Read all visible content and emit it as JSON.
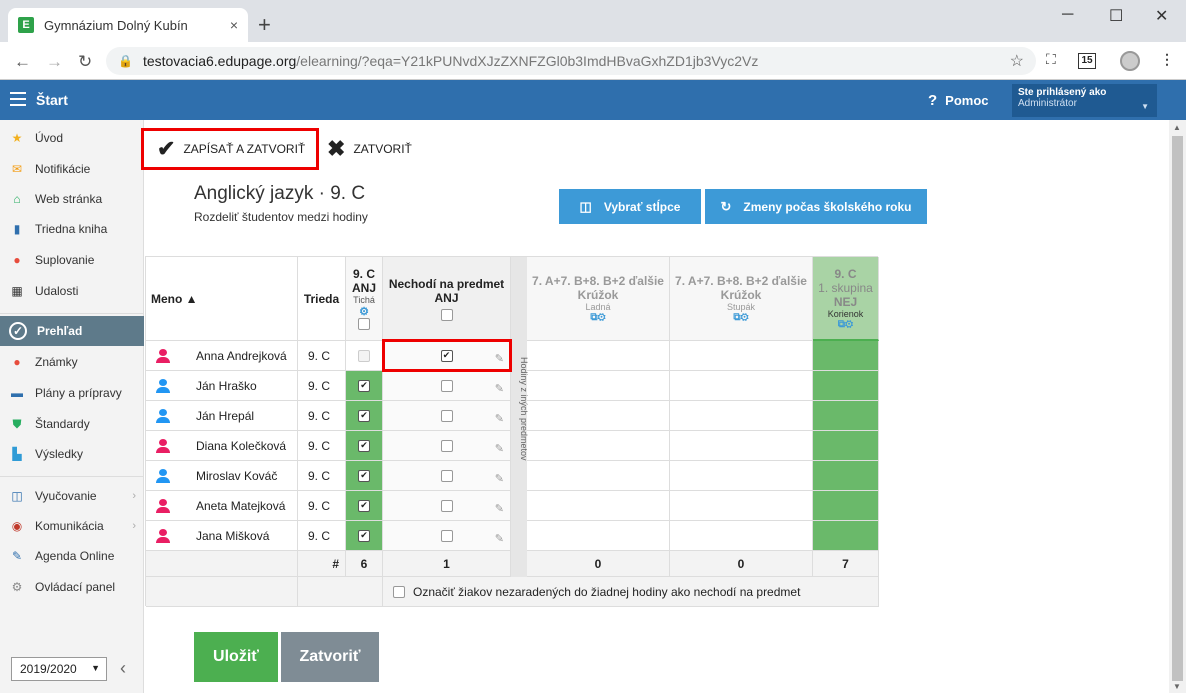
{
  "browser": {
    "tab_title": "Gymnázium Dolný Kubín",
    "favicon_letter": "E",
    "tab_close": "×",
    "new_tab": "+",
    "url_domain": "testovacia6.edupage.org",
    "url_path": "/elearning/?eqa=Y21kPUNvdXJzZXNFZGl0b3ImdHBvaGxhZD1jb3Vyc2Vz",
    "ext_badge": "15"
  },
  "header": {
    "menu_label": "Štart",
    "help_label": "Pomoc",
    "user_line1": "Ste prihlásený ako",
    "user_line2": "Administrátor"
  },
  "sidebar": {
    "items": [
      {
        "label": "Úvod",
        "icon": "star-icon"
      },
      {
        "label": "Notifikácie",
        "icon": "envelope-icon"
      },
      {
        "label": "Web stránka",
        "icon": "home-icon"
      },
      {
        "label": "Triedna kniha",
        "icon": "book-icon"
      },
      {
        "label": "Suplovanie",
        "icon": "person-icon"
      },
      {
        "label": "Udalosti",
        "icon": "calendar-icon"
      },
      {
        "label": "Prehľad",
        "icon": "check-circle-icon"
      },
      {
        "label": "Známky",
        "icon": "grade-icon"
      },
      {
        "label": "Plány a prípravy",
        "icon": "briefcase-icon"
      },
      {
        "label": "Štandardy",
        "icon": "shield-icon"
      },
      {
        "label": "Výsledky",
        "icon": "bar-chart-icon"
      },
      {
        "label": "Vyučovanie",
        "icon": "open-book-icon"
      },
      {
        "label": "Komunikácia",
        "icon": "chat-icon"
      },
      {
        "label": "Agenda Online",
        "icon": "pen-icon"
      },
      {
        "label": "Ovládací panel",
        "icon": "gear-icon"
      }
    ],
    "year": "2019/2020"
  },
  "toolbar": {
    "save_close": "ZAPÍSAŤ A ZATVORIŤ",
    "close": "ZATVORIŤ"
  },
  "page": {
    "title": "Anglický jazyk · 9. C",
    "subtitle": "Rozdeliť študentov medzi hodiny",
    "btn_columns": "Vybrať stĺpce",
    "btn_changes": "Zmeny počas školského roku"
  },
  "table": {
    "col_name": "Meno ▲",
    "col_class": "Trieda",
    "col_group": {
      "line1": "9. C",
      "line2": "ANJ",
      "line3": "Tichá"
    },
    "col_notsubject": {
      "line1": "Nechodí na predmet",
      "line2": "ANJ"
    },
    "strip_text": "Hodiny z iných predmetov",
    "col_k1": {
      "line1": "7. A+7. B+8. B+2 ďalšie",
      "line2": "Krúžok",
      "line3": "Ladná"
    },
    "col_k2": {
      "line1": "7. A+7. B+8. B+2 ďalšie",
      "line2": "Krúžok",
      "line3": "Stupák"
    },
    "col_g": {
      "line1": "9. C",
      "line2": "1. skupina",
      "line3": "NEJ",
      "line4": "Korienok"
    },
    "students": [
      {
        "name": "Anna Andrejková",
        "class": "9. C",
        "gender": "f",
        "group": false,
        "not_subject": true
      },
      {
        "name": "Ján Hraško",
        "class": "9. C",
        "gender": "m",
        "group": true,
        "not_subject": false
      },
      {
        "name": "Ján Hrepál",
        "class": "9. C",
        "gender": "m",
        "group": true,
        "not_subject": false
      },
      {
        "name": "Diana Kolečková",
        "class": "9. C",
        "gender": "f",
        "group": true,
        "not_subject": false
      },
      {
        "name": "Miroslav Kováč",
        "class": "9. C",
        "gender": "m",
        "group": true,
        "not_subject": false
      },
      {
        "name": "Aneta Matejková",
        "class": "9. C",
        "gender": "f",
        "group": true,
        "not_subject": false
      },
      {
        "name": "Jana Mišková",
        "class": "9. C",
        "gender": "f",
        "group": true,
        "not_subject": false
      }
    ],
    "footer": {
      "hash": "#",
      "group": "6",
      "notsubject": "1",
      "k1": "0",
      "k2": "0",
      "g": "7"
    },
    "mark_label": "Označiť žiakov nezaradených do žiadnej hodiny ako nechodí na predmet"
  },
  "buttons": {
    "save": "Uložiť",
    "close": "Zatvoriť"
  },
  "colors": {
    "header_blue": "#2f6fad",
    "button_blue": "#3d9ad7",
    "save_green": "#4caf50",
    "close_gray": "#7f8c95",
    "female": "#e91e63",
    "male": "#2196f3",
    "group_green": "#6ab96a"
  }
}
